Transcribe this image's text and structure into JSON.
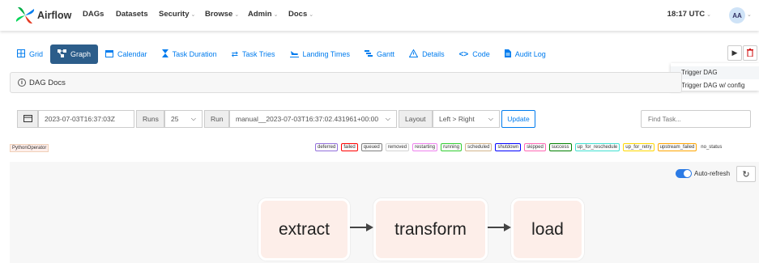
{
  "navbar": {
    "brand": "Airflow",
    "items": [
      {
        "label": "DAGs",
        "caret": false
      },
      {
        "label": "Datasets",
        "caret": false
      },
      {
        "label": "Security",
        "caret": true
      },
      {
        "label": "Browse",
        "caret": true
      },
      {
        "label": "Admin",
        "caret": true
      },
      {
        "label": "Docs",
        "caret": true
      }
    ],
    "time": "18:17 UTC",
    "avatar_initials": "AA"
  },
  "tabs": [
    {
      "label": "Grid",
      "icon": "grid-icon",
      "active": false
    },
    {
      "label": "Graph",
      "icon": "graph-icon",
      "active": true
    },
    {
      "label": "Calendar",
      "icon": "calendar-icon",
      "active": false
    },
    {
      "label": "Task Duration",
      "icon": "hourglass-icon",
      "active": false
    },
    {
      "label": "Task Tries",
      "icon": "retry-icon",
      "active": false
    },
    {
      "label": "Landing Times",
      "icon": "landing-plane-icon",
      "active": false
    },
    {
      "label": "Gantt",
      "icon": "gantt-icon",
      "active": false
    },
    {
      "label": "Details",
      "icon": "warning-triangle-icon",
      "active": false
    },
    {
      "label": "Code",
      "icon": "code-icon",
      "active": false
    },
    {
      "label": "Audit Log",
      "icon": "document-icon",
      "active": false
    }
  ],
  "trigger_menu": [
    "Trigger DAG",
    "Trigger DAG w/ config"
  ],
  "docs_label": "DAG Docs",
  "controls": {
    "base_date": "2023-07-03T16:37:03Z",
    "runs_label": "Runs",
    "runs_value": "25",
    "run_label": "Run",
    "run_value": "manual__2023-07-03T16:37:02.431961+00:00",
    "layout_label": "Layout",
    "layout_value": "Left > Right",
    "update_label": "Update",
    "find_placeholder": "Find Task..."
  },
  "operator_badge": "PythonOperator",
  "states": [
    {
      "label": "deferred",
      "color": "#9370db"
    },
    {
      "label": "failed",
      "color": "#ff0000"
    },
    {
      "label": "queued",
      "color": "#808080"
    },
    {
      "label": "removed",
      "color": "#d3d3d3"
    },
    {
      "label": "restarting",
      "color": "#ee82ee"
    },
    {
      "label": "running",
      "color": "#32cd32"
    },
    {
      "label": "scheduled",
      "color": "#d2b48c"
    },
    {
      "label": "shutdown",
      "color": "#0000ff"
    },
    {
      "label": "skipped",
      "color": "#ff69b4"
    },
    {
      "label": "success",
      "color": "#008000"
    },
    {
      "label": "up_for_reschedule",
      "color": "#40e0d0"
    },
    {
      "label": "up_for_retry",
      "color": "#ffd700"
    },
    {
      "label": "upstream_failed",
      "color": "#ffa500"
    }
  ],
  "no_status_label": "no_status",
  "autorefresh_label": "Auto-refresh",
  "nodes": [
    "extract",
    "transform",
    "load"
  ]
}
